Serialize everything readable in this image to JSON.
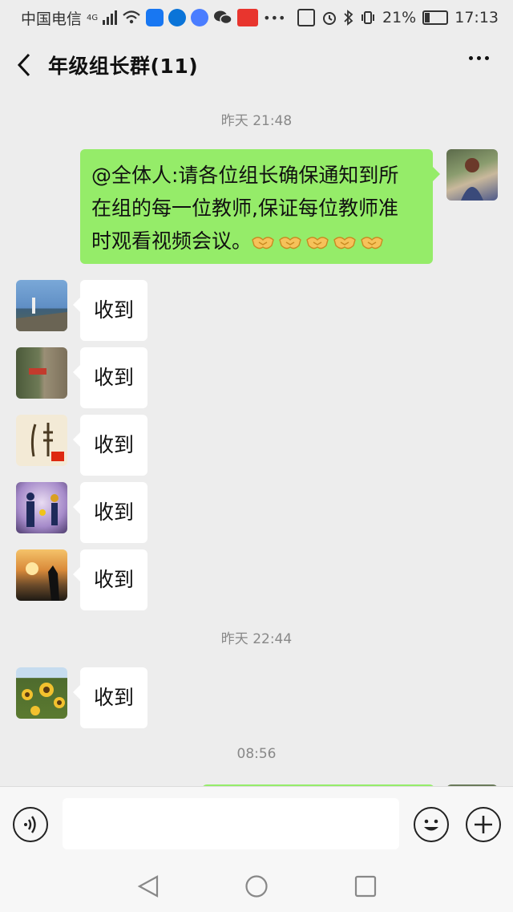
{
  "status_bar": {
    "carrier": "中国电信",
    "network": "4G",
    "battery": "21%",
    "time": "17:13"
  },
  "header": {
    "title": "年级组长群(11)"
  },
  "chat": {
    "timestamps": [
      "昨天 21:48",
      "昨天 22:44",
      "08:56"
    ],
    "sent_message": {
      "lines": [
        "@全体人:请各位组长确保通知到所",
        "在组的每一位教师,保证每位教师准",
        "时观看视频会议。"
      ],
      "emoji": "handshake-emoji",
      "emoji_count": 5
    },
    "received": [
      {
        "text": "收到",
        "avatar": "lighthouse-avatar"
      },
      {
        "text": "收到",
        "avatar": "tree-trunk-avatar"
      },
      {
        "text": "收到",
        "avatar": "wheat-calligraphy-avatar"
      },
      {
        "text": "收到",
        "avatar": "family-silhouette-avatar"
      },
      {
        "text": "收到",
        "avatar": "sunset-silhouette-avatar"
      },
      {
        "text": "收到",
        "avatar": "sunflower-field-avatar"
      }
    ]
  },
  "input_bar": {
    "value": "",
    "voice_icon": "voice-icon",
    "emoji_icon": "emoji-icon",
    "plus_icon": "plus-icon"
  },
  "colors": {
    "background": "#ededed",
    "sent_bubble": "#95ec69",
    "received_bubble": "#ffffff",
    "timestamp": "#888888"
  }
}
